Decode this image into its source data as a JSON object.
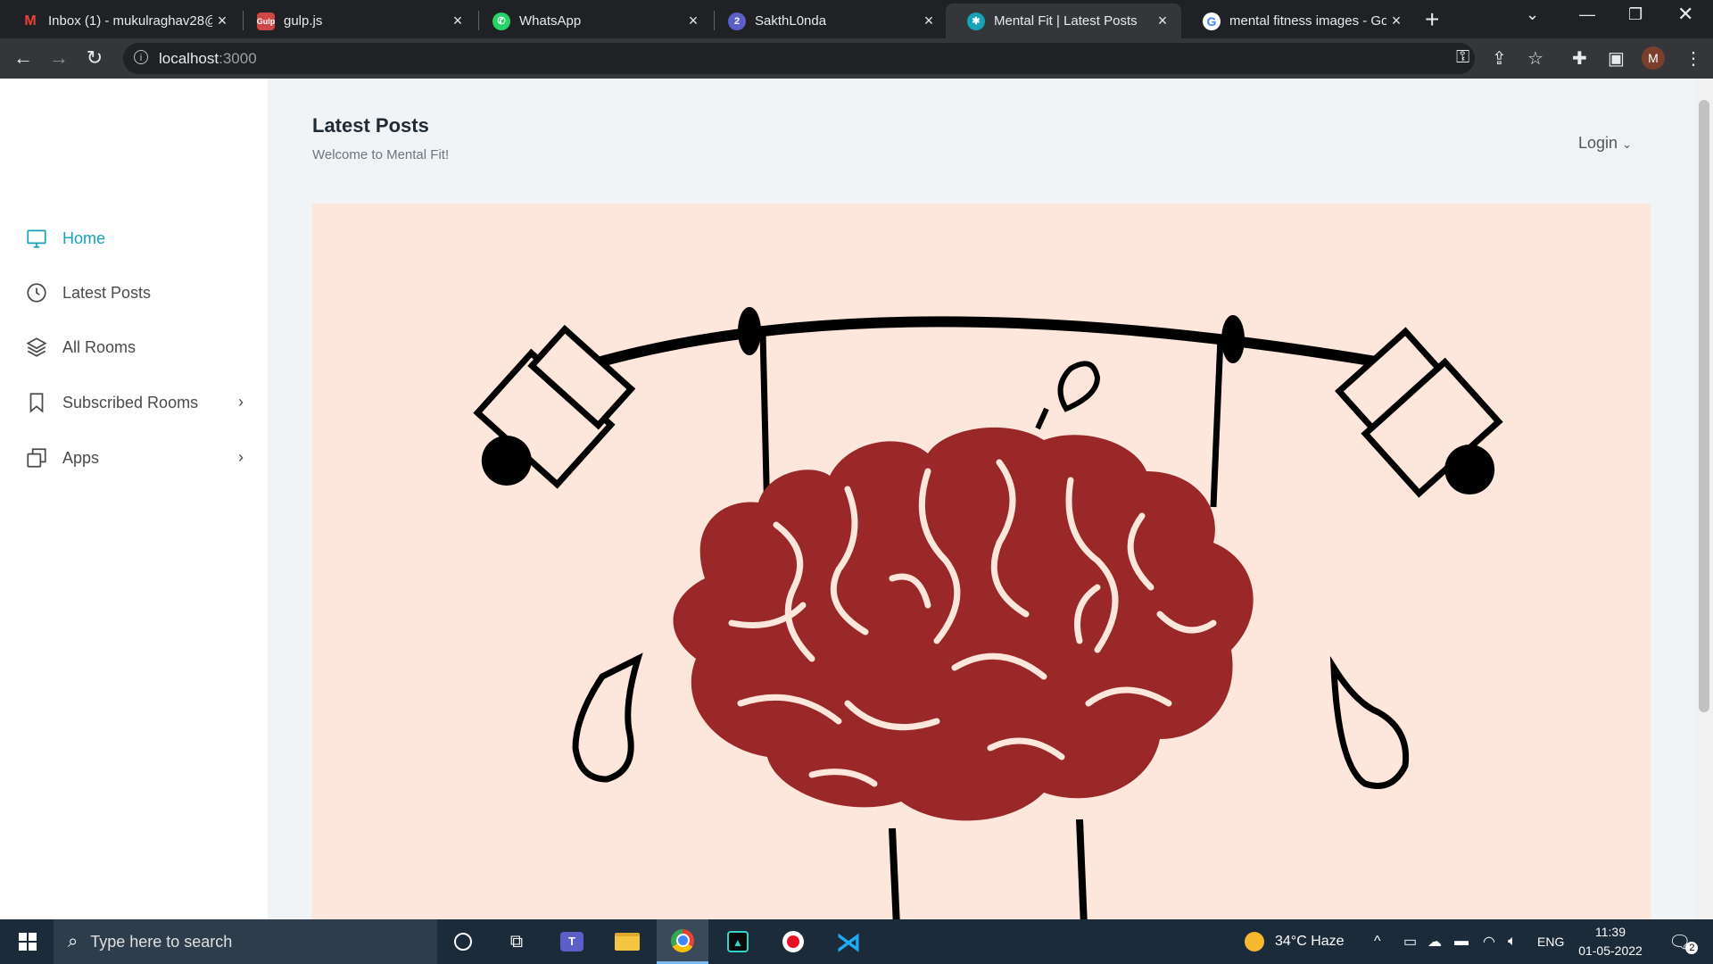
{
  "browser": {
    "tabs": [
      {
        "title": "Inbox (1) - mukulraghav28@",
        "favicon": "gmail-icon",
        "color": "#ea4335"
      },
      {
        "title": "gulp.js",
        "favicon": "gulp-icon",
        "color": "#cf4646"
      },
      {
        "title": "WhatsApp",
        "favicon": "whatsapp-icon",
        "color": "#25d366"
      },
      {
        "title": "SakthL0nda",
        "favicon": "notification-icon",
        "color": "#5b5fc7",
        "badge": "2"
      },
      {
        "title": "Mental Fit | Latest Posts",
        "favicon": "site-icon",
        "color": "#17a2b8",
        "active": true
      },
      {
        "title": "mental fitness images - Goo",
        "favicon": "google-icon",
        "color": "#4285f4"
      }
    ],
    "url_host": "localhost",
    "url_port": ":3000",
    "profile_initial": "M"
  },
  "page": {
    "title": "Latest Posts",
    "subtitle": "Welcome to Mental Fit!",
    "login_label": "Login",
    "accent": "#17a2b8",
    "hero_bg": "#fde6dc",
    "brain_color": "#9b2828"
  },
  "sidebar": {
    "items": [
      {
        "label": "Home",
        "icon": "monitor-icon",
        "active": true
      },
      {
        "label": "Latest Posts",
        "icon": "clock-icon"
      },
      {
        "label": "All Rooms",
        "icon": "layers-icon"
      },
      {
        "label": "Subscribed Rooms",
        "icon": "bookmark-icon",
        "has_submenu": true
      },
      {
        "label": "Apps",
        "icon": "windows-copy-icon",
        "has_submenu": true
      }
    ]
  },
  "taskbar": {
    "search_placeholder": "Type here to search",
    "weather": "34°C  Haze",
    "lang": "ENG",
    "time": "11:39",
    "date": "01-05-2022",
    "notification_count": "2"
  }
}
